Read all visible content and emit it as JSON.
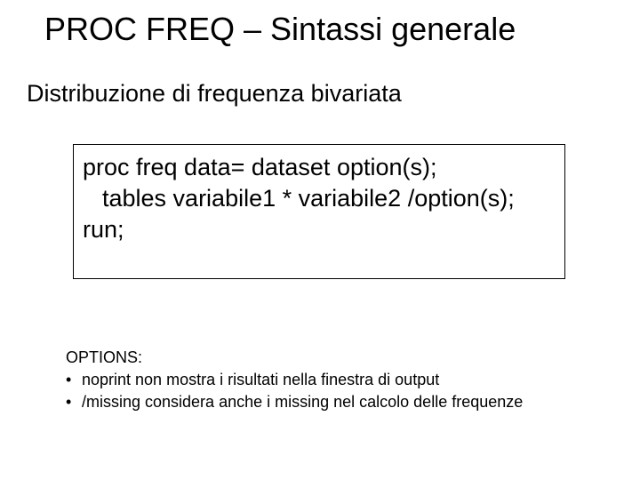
{
  "title": "PROC FREQ – Sintassi generale",
  "subtitle": "Distribuzione di frequenza bivariata",
  "code": {
    "line1": "proc freq data= dataset option(s);",
    "line2": "tables variabile1 * variabile2 /option(s);",
    "line3": "run;"
  },
  "options": {
    "heading": "OPTIONS:",
    "item1": "noprint   non mostra i risultati nella finestra di output",
    "item2": "/missing   considera anche i missing nel calcolo delle frequenze"
  }
}
